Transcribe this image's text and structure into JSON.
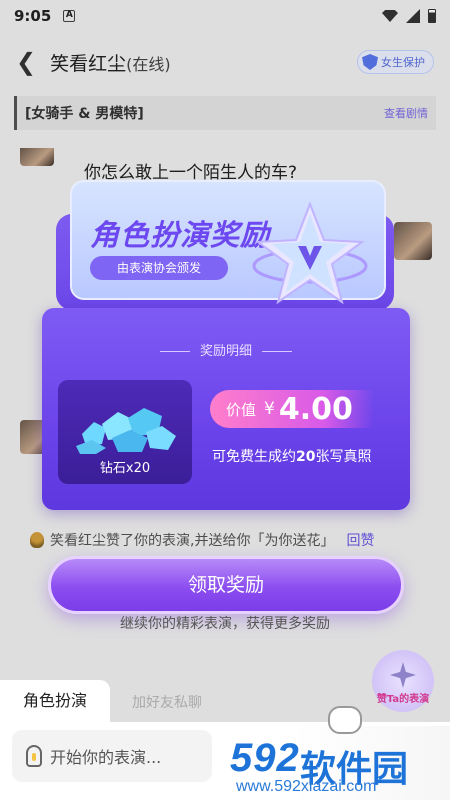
{
  "status_bar": {
    "time": "9:05",
    "notif_icon": "A"
  },
  "top_bar": {
    "title": "笑看红尘",
    "online": "(在线)",
    "guard_label": "女生保护"
  },
  "scene": {
    "tag": "[女骑手 & 男模特]",
    "view_plot": "查看剧情"
  },
  "chat": {
    "message_1": "你怎么敢上一个陌生人的车?"
  },
  "reward": {
    "banner_title": "角色扮演奖励",
    "banner_sub": "由表演协会颁发",
    "detail_title": "奖励明细",
    "gem_label": "钻石x20",
    "value_label": "价值",
    "currency": "¥",
    "amount": "4.00",
    "free_text_pre": "可免费生成约",
    "free_count": "20",
    "free_text_post": "张写真照"
  },
  "like_line": {
    "text": "笑看红尘赞了你的表演,并送给你「为你送花」",
    "reply": "回赞"
  },
  "claim_button": "领取奖励",
  "more_text": "继续你的精彩表演，获得更多奖励",
  "praise_button": "赞Ta的表演",
  "bottom": {
    "tab_roleplay": "角色扮演",
    "tab_private": "加好友私聊",
    "input_placeholder": "开始你的表演..."
  },
  "watermark": {
    "logo": "592",
    "name": "软件园",
    "url": "www.592xiazai.com"
  }
}
